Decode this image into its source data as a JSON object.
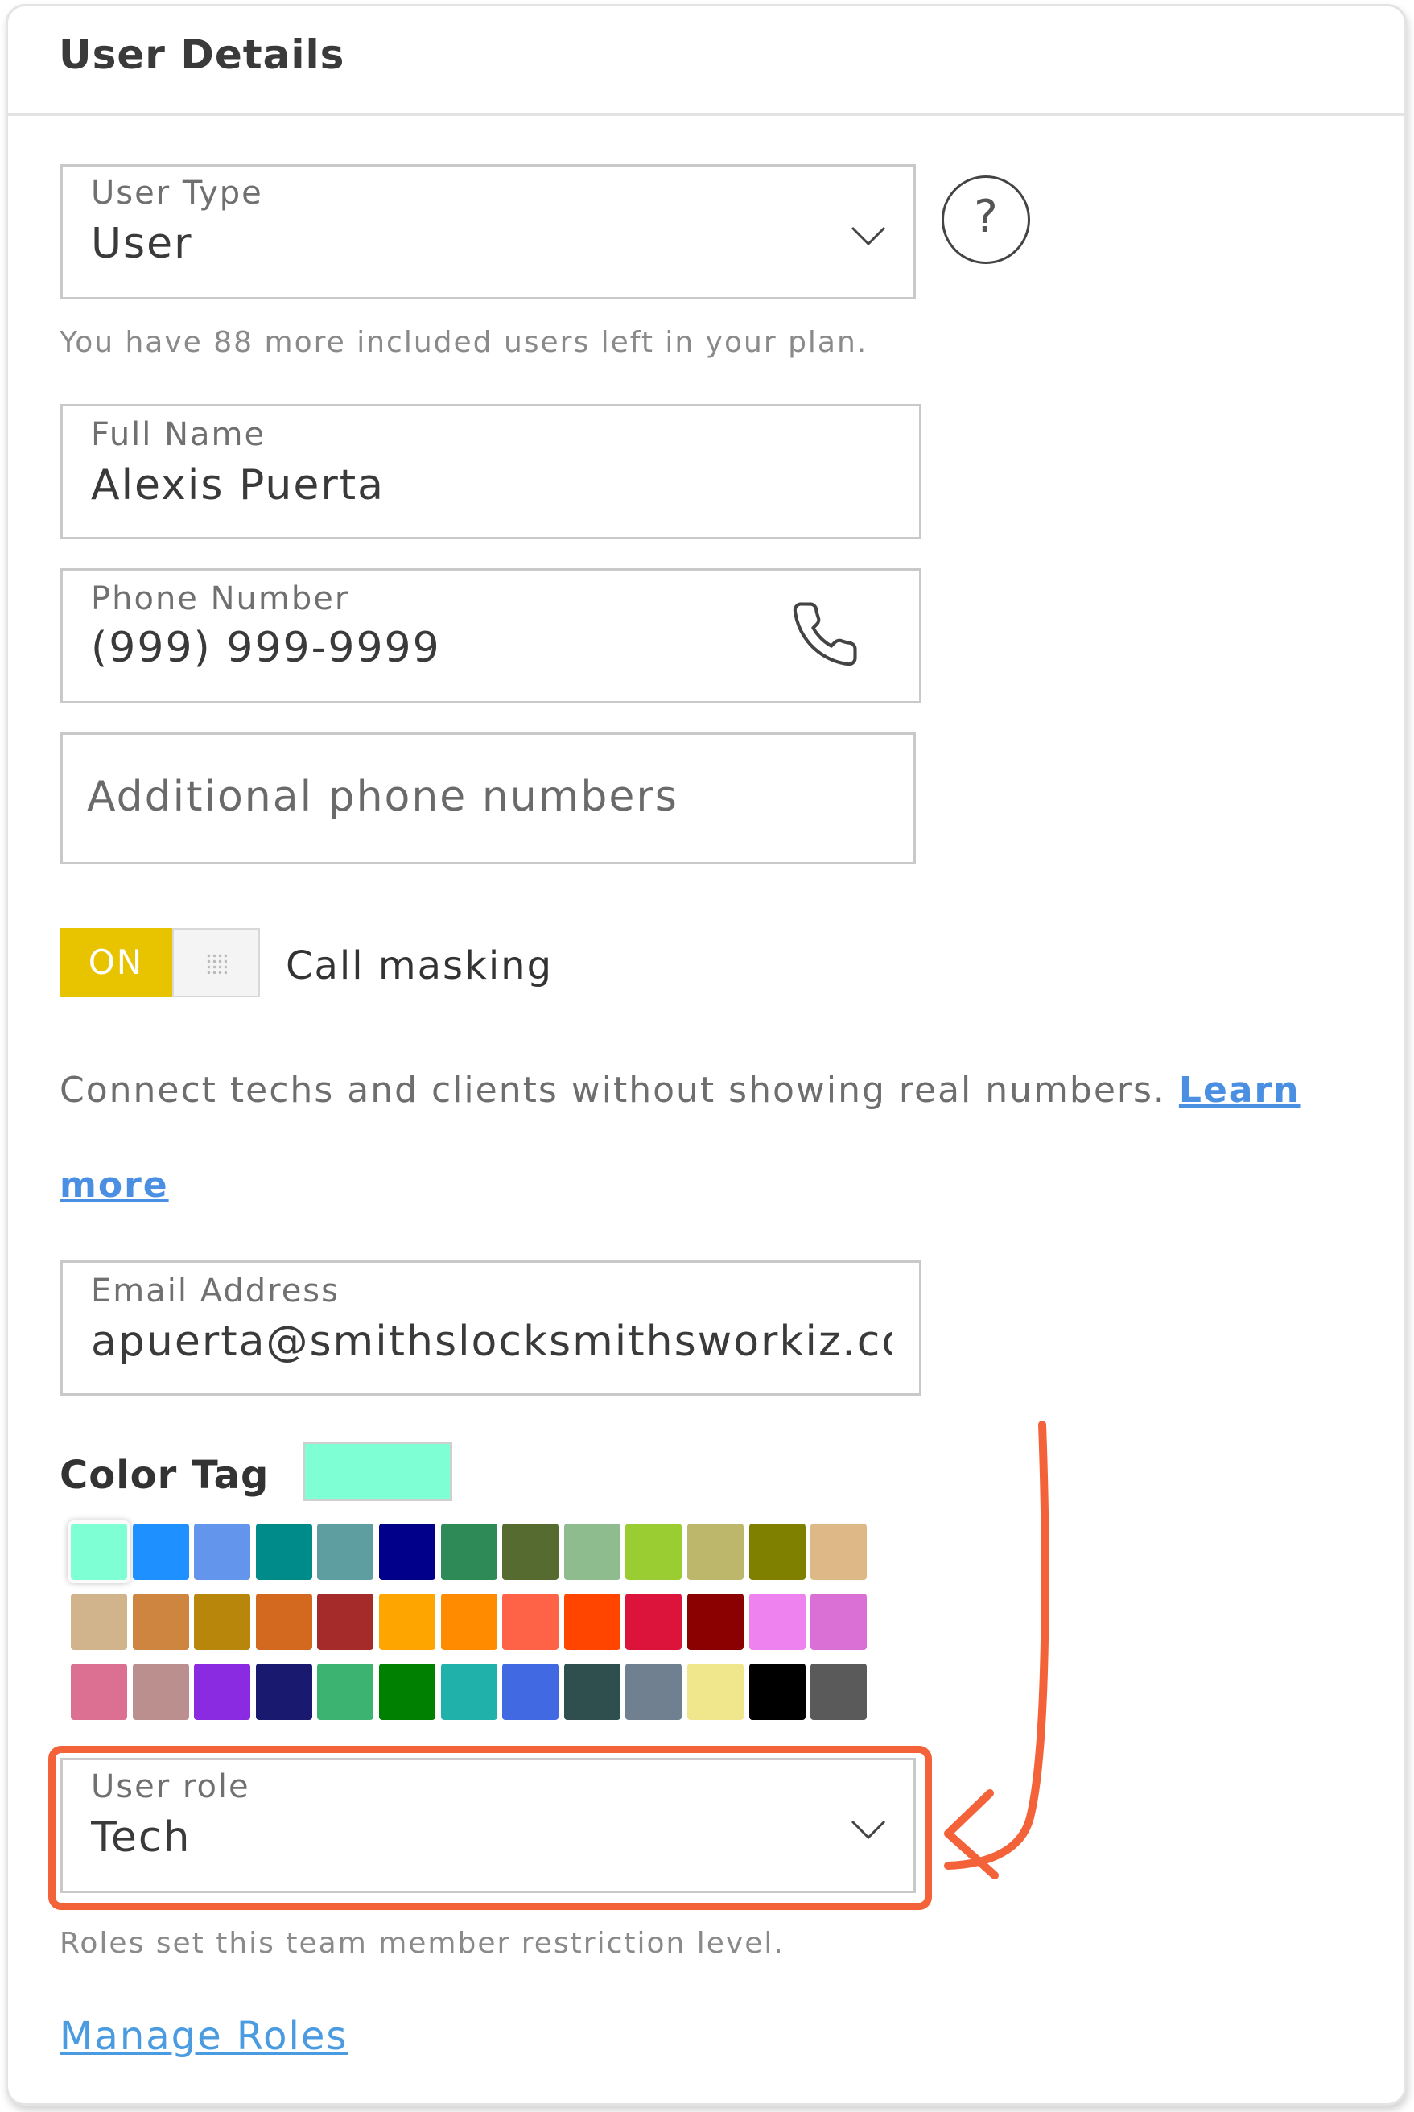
{
  "card": {
    "title": "User Details"
  },
  "user_type": {
    "label": "User Type",
    "value": "User",
    "note": "You have 88 more included users left in your plan."
  },
  "full_name": {
    "label": "Full Name",
    "value": "Alexis Puerta"
  },
  "phone": {
    "label": "Phone Number",
    "value": "(999) 999-9999"
  },
  "additional_phones": {
    "placeholder": "Additional phone numbers"
  },
  "call_masking": {
    "toggle_state": "ON",
    "label": "Call masking",
    "description": "Connect techs and clients without showing real numbers.",
    "link_text": "Learn more"
  },
  "email": {
    "label": "Email Address",
    "value": "apuerta@smithslocksmithsworkiz.co"
  },
  "color_tag": {
    "label": "Color Tag",
    "selected_color": "#7fffd4",
    "swatches": [
      [
        "#7fffd4",
        "#1e90ff",
        "#6495ed",
        "#008b8b",
        "#5f9ea0",
        "#00008b",
        "#2e8b57",
        "#556b2f",
        "#8fbc8f",
        "#9acd32",
        "#bdb76b",
        "#808000",
        "#deb887"
      ],
      [
        "#d2b48c",
        "#cd853f",
        "#b8860b",
        "#d2691e",
        "#a52a2a",
        "#ffa500",
        "#ff8c00",
        "#ff6347",
        "#ff4500",
        "#dc143c",
        "#8b0000",
        "#ee82ee",
        "#da70d6"
      ],
      [
        "#db7093",
        "#bc8f8f",
        "#8a2be2",
        "#191970",
        "#3cb371",
        "#008000",
        "#20b2aa",
        "#4169e1",
        "#2f4f4f",
        "#708090",
        "#f0e68c",
        "#000000",
        "#5a5a5a"
      ]
    ]
  },
  "user_role": {
    "label": "User role",
    "value": "Tech",
    "note": "Roles set this team member restriction level."
  },
  "manage_roles": {
    "link_text": "Manage Roles"
  },
  "colors": {
    "toggle_on": "#e8c300",
    "link": "#4a9be0",
    "highlight": "#f4623a"
  }
}
